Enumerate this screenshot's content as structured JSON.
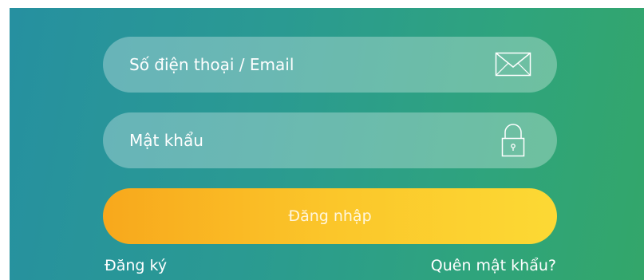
{
  "form": {
    "phone_email_placeholder": "Số điện thoại / Email",
    "password_placeholder": "Mật khẩu",
    "login_label": "Đăng nhập",
    "register_label": "Đăng ký",
    "forgot_password_label": "Quên mật khẩu?"
  },
  "icons": {
    "email": "envelope-icon",
    "password": "lock-icon"
  },
  "colors": {
    "background_start": "#2690a0",
    "background_end": "#33a66a",
    "field_fill": "rgba(255,255,255,0.30)",
    "button_start": "#f8a81c",
    "button_end": "#fcd934",
    "text": "#ffffff"
  }
}
